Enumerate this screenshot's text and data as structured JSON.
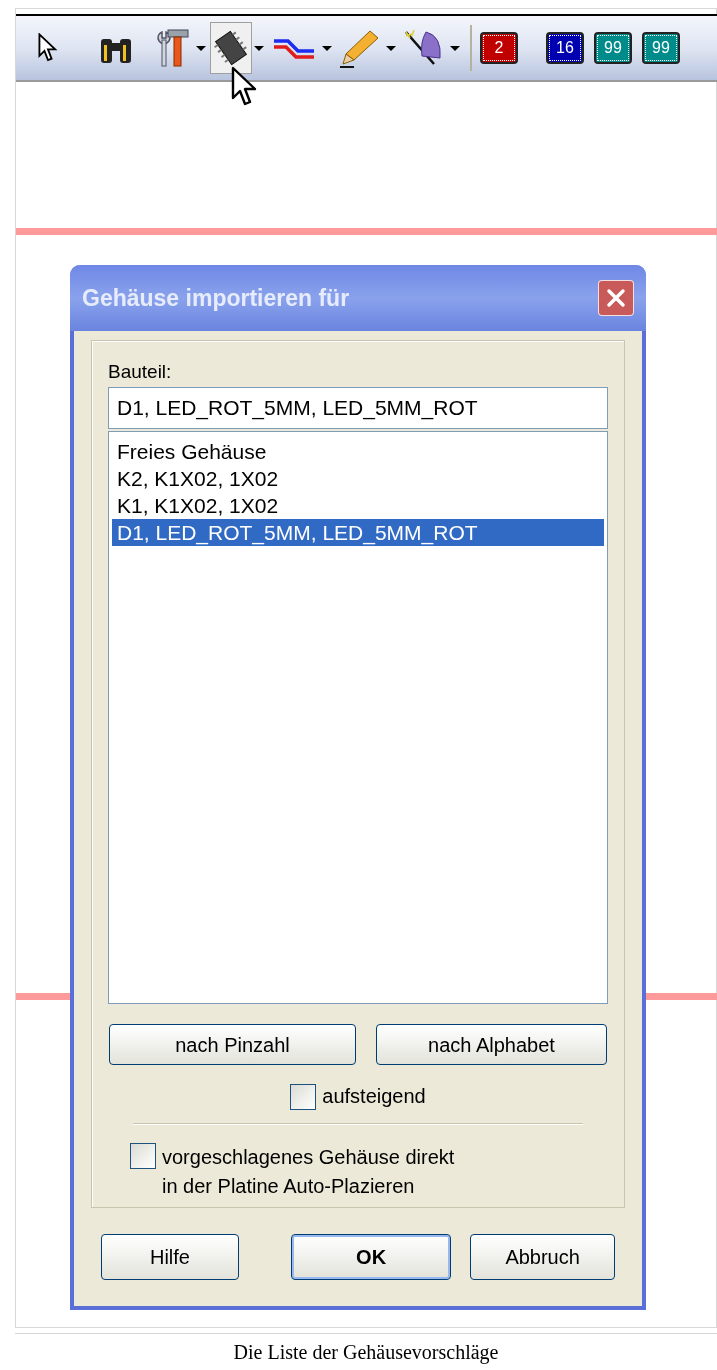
{
  "toolbar": {
    "tools": [
      {
        "dropdown": false,
        "selected": false
      },
      {
        "dropdown": false,
        "selected": false
      },
      {
        "dropdown": true,
        "selected": false
      },
      {
        "dropdown": true,
        "selected": true
      },
      {
        "dropdown": true,
        "selected": false
      },
      {
        "dropdown": true,
        "selected": false
      },
      {
        "dropdown": true,
        "selected": false
      }
    ],
    "badges": [
      {
        "text": "2",
        "color": "#c00000"
      },
      {
        "text": "16",
        "color": "#0000b0"
      },
      {
        "text": "99",
        "color": "#008b8b"
      },
      {
        "text": "99",
        "color": "#008b8b"
      }
    ]
  },
  "dialog": {
    "title": "Gehäuse importieren für",
    "field": {
      "label": "Bauteil:",
      "value": "D1, LED_ROT_5MM, LED_5MM_ROT"
    },
    "list": [
      {
        "text": "Freies Gehäuse",
        "selected": false
      },
      {
        "text": "K2, K1X02, 1X02",
        "selected": false
      },
      {
        "text": "K1, K1X02, 1X02",
        "selected": false
      },
      {
        "text": "D1, LED_ROT_5MM, LED_5MM_ROT",
        "selected": true
      }
    ],
    "sort_buttons": [
      "nach Pinzahl",
      "nach Alphabet"
    ],
    "ascending": {
      "label": "aufsteigend",
      "checked": false
    },
    "auto_place": {
      "label": "vorgeschlagenes Gehäuse direkt\nin der Platine Auto-Plazieren",
      "checked": false
    },
    "buttons": [
      {
        "label": "Hilfe",
        "default": false
      },
      {
        "label": "OK",
        "default": true
      },
      {
        "label": "Abbruch",
        "default": false
      }
    ]
  },
  "caption": "Die Liste der Gehäusevorschläge"
}
